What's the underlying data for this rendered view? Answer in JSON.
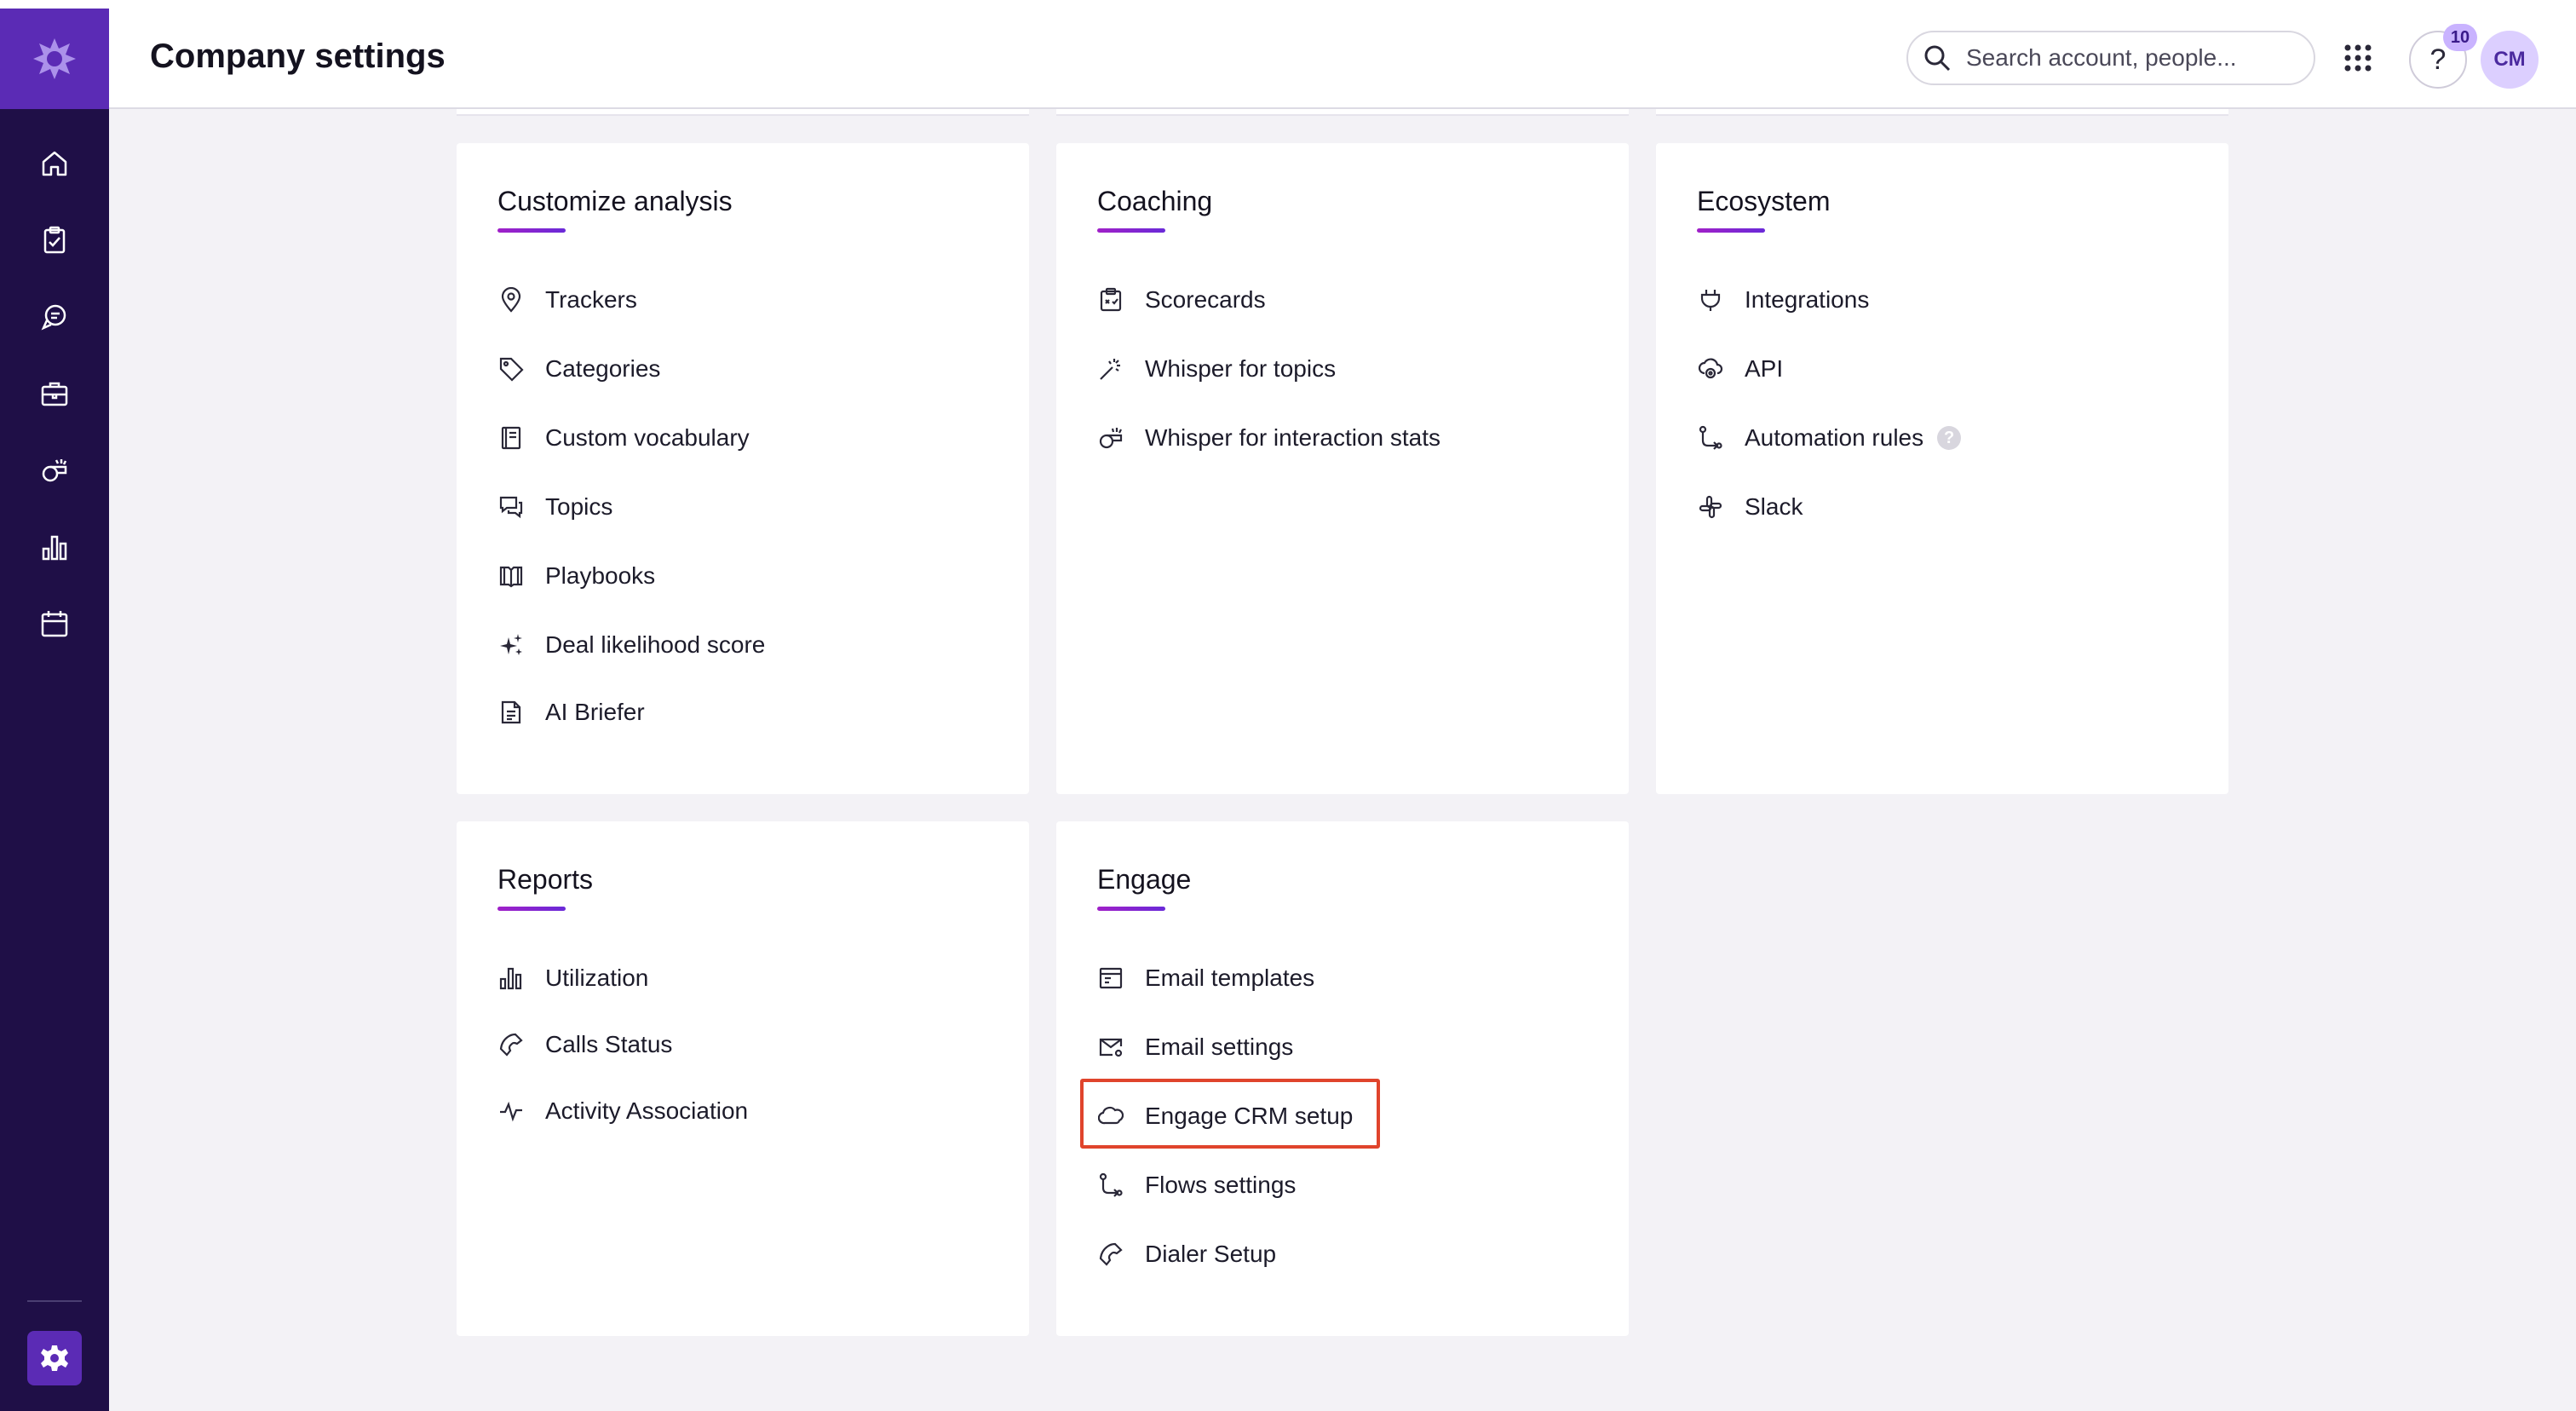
{
  "header": {
    "title": "Company settings",
    "search_placeholder": "Search account, people...",
    "notification_count": "10",
    "help_label": "?",
    "avatar_initials": "CM"
  },
  "sidebar": {
    "items": [
      {
        "icon": "home-icon"
      },
      {
        "icon": "clipboard-check-icon"
      },
      {
        "icon": "chat-bubbles-icon"
      },
      {
        "icon": "briefcase-icon"
      },
      {
        "icon": "whistle-icon"
      },
      {
        "icon": "bar-chart-icon"
      },
      {
        "icon": "calendar-icon"
      }
    ],
    "settings_icon": "gear-icon"
  },
  "cards": {
    "customize": {
      "title": "Customize analysis",
      "items": [
        "Trackers",
        "Categories",
        "Custom vocabulary",
        "Topics",
        "Playbooks",
        "Deal likelihood score",
        "AI Briefer"
      ]
    },
    "coaching": {
      "title": "Coaching",
      "items": [
        "Scorecards",
        "Whisper for topics",
        "Whisper for interaction stats"
      ]
    },
    "ecosystem": {
      "title": "Ecosystem",
      "items": [
        "Integrations",
        "API",
        "Automation rules",
        "Slack"
      ]
    },
    "reports": {
      "title": "Reports",
      "items": [
        "Utilization",
        "Calls Status",
        "Activity Association"
      ]
    },
    "engage": {
      "title": "Engage",
      "items": [
        "Email templates",
        "Email settings",
        "Engage CRM setup",
        "Flows settings",
        "Dialer Setup"
      ]
    }
  },
  "colors": {
    "sidebar": "#1f0f47",
    "brand": "#5b2bb5",
    "highlight": "#e0442c",
    "accent_gradient_start": "#a020c8",
    "accent_gradient_end": "#6a2ad8"
  }
}
